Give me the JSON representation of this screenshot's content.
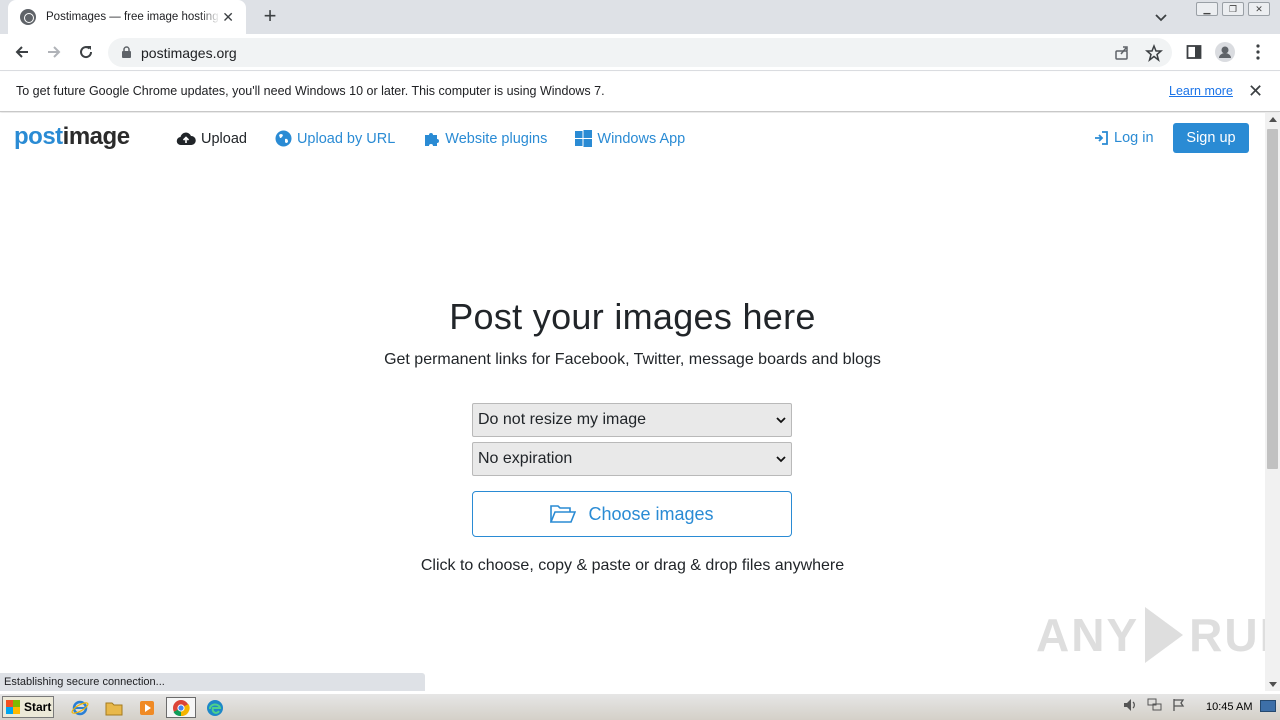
{
  "browser": {
    "tab_title": "Postimages — free image hosting / image upload",
    "url": "postimages.org",
    "window_controls": [
      "minimize",
      "restore",
      "close"
    ]
  },
  "infobar": {
    "message": "To get future Google Chrome updates, you'll need Windows 10 or later. This computer is using Windows 7.",
    "learn_more": "Learn more"
  },
  "site": {
    "logo_part1": "post",
    "logo_part2": "image",
    "nav": [
      {
        "label": "Upload",
        "icon": "cloud-upload-icon"
      },
      {
        "label": "Upload by URL",
        "icon": "globe-icon"
      },
      {
        "label": "Website plugins",
        "icon": "puzzle-icon"
      },
      {
        "label": "Windows App",
        "icon": "windows-icon"
      }
    ],
    "login": "Log in",
    "signup": "Sign up"
  },
  "hero": {
    "title": "Post your images here",
    "subtitle": "Get permanent links for Facebook, Twitter, message boards and blogs",
    "resize_select": "Do not resize my image",
    "expiration_select": "No expiration",
    "choose_button": "Choose images",
    "hint": "Click to choose, copy & paste or drag & drop files anywhere"
  },
  "status_bar": "Establishing secure connection...",
  "watermark": {
    "left": "ANY",
    "right": "RUN"
  },
  "taskbar": {
    "start": "Start",
    "apps": [
      "internet-explorer-icon",
      "file-explorer-icon",
      "media-player-icon",
      "chrome-icon",
      "edge-icon"
    ],
    "clock": "10:45 AM"
  },
  "colors": {
    "brand_blue": "#2a8bd4",
    "chrome_frame": "#dee1e6"
  }
}
